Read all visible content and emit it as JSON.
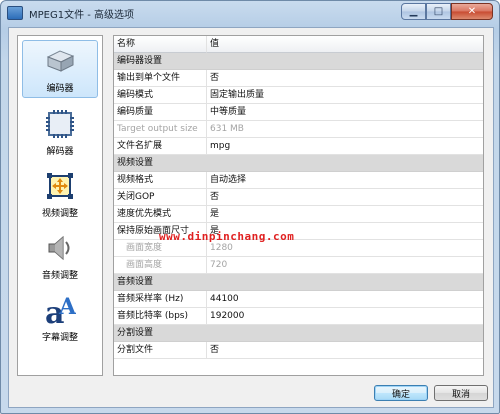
{
  "window": {
    "title": "MPEG1文件 - 高级选项"
  },
  "sidebar": {
    "items": [
      {
        "label": "编码器",
        "icon": "encoder-icon",
        "active": true
      },
      {
        "label": "解码器",
        "icon": "decoder-icon",
        "active": false
      },
      {
        "label": "视频调整",
        "icon": "video-adjust-icon",
        "active": false
      },
      {
        "label": "音频调整",
        "icon": "audio-adjust-icon",
        "active": false
      },
      {
        "label": "字幕调整",
        "icon": "subtitle-adjust-icon",
        "active": false
      }
    ]
  },
  "grid": {
    "header": {
      "name": "名称",
      "value": "值"
    },
    "rows": [
      {
        "type": "category",
        "name": "编码器设置",
        "value": ""
      },
      {
        "type": "prop",
        "name": "输出到单个文件",
        "value": "否"
      },
      {
        "type": "prop",
        "name": "编码模式",
        "value": "固定输出质量"
      },
      {
        "type": "prop",
        "name": "编码质量",
        "value": "中等质量"
      },
      {
        "type": "disabled",
        "name": "Target output size",
        "value": "631 MB"
      },
      {
        "type": "prop",
        "name": "文件名扩展",
        "value": "mpg"
      },
      {
        "type": "category",
        "name": "视频设置",
        "value": ""
      },
      {
        "type": "prop",
        "name": "视频格式",
        "value": "自动选择"
      },
      {
        "type": "prop",
        "name": "关闭GOP",
        "value": "否"
      },
      {
        "type": "prop",
        "name": "速度优先模式",
        "value": "是"
      },
      {
        "type": "prop",
        "name": "保持原始画面尺寸",
        "value": "是"
      },
      {
        "type": "disabled-indent",
        "name": "画面宽度",
        "value": "1280"
      },
      {
        "type": "disabled-indent",
        "name": "画面高度",
        "value": "720"
      },
      {
        "type": "category",
        "name": "音频设置",
        "value": ""
      },
      {
        "type": "prop",
        "name": "音频采样率 (Hz)",
        "value": "44100"
      },
      {
        "type": "prop",
        "name": "音频比特率 (bps)",
        "value": "192000"
      },
      {
        "type": "category",
        "name": "分割设置",
        "value": ""
      },
      {
        "type": "prop",
        "name": "分割文件",
        "value": "否"
      }
    ]
  },
  "watermark": "www.dinpinchang.com",
  "buttons": {
    "ok": "确定",
    "cancel": "取消"
  }
}
